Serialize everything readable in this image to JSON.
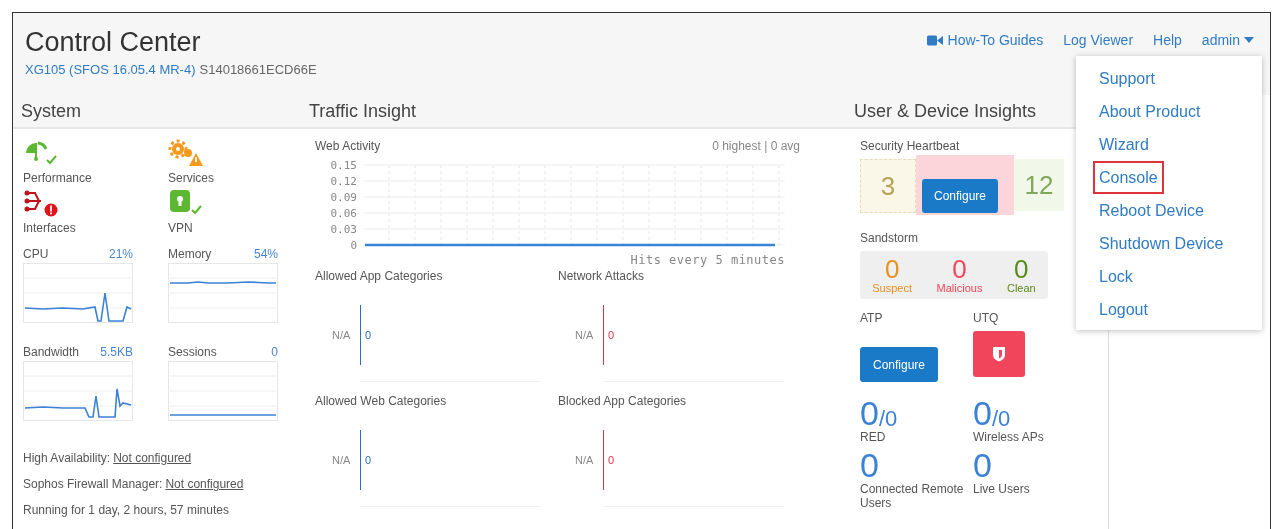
{
  "header": {
    "title": "Control Center",
    "model": "XG105 (SFOS 16.05.4 MR-4)",
    "serial": "S14018661ECD66E"
  },
  "nav": {
    "links": [
      "How-To Guides",
      "Log Viewer",
      "Help"
    ],
    "user": "admin"
  },
  "user_menu": [
    {
      "label": "Support",
      "selected": false
    },
    {
      "label": "About Product",
      "selected": false
    },
    {
      "label": "Wizard",
      "selected": false
    },
    {
      "label": "Console",
      "selected": true
    },
    {
      "label": "Reboot Device",
      "selected": false
    },
    {
      "label": "Shutdown Device",
      "selected": false
    },
    {
      "label": "Lock",
      "selected": false
    },
    {
      "label": "Logout",
      "selected": false
    }
  ],
  "system": {
    "title": "System",
    "statuses": [
      {
        "kind": "performance",
        "label": "Performance",
        "badge": {
          "kind": "check",
          "color": "#5cb82e"
        }
      },
      {
        "kind": "services",
        "label": "Services",
        "badge": {
          "kind": "warning",
          "color": "#f39a1e"
        }
      },
      {
        "kind": "interfaces",
        "label": "Interfaces",
        "badge": {
          "kind": "error",
          "color": "#e0121b"
        }
      },
      {
        "kind": "vpn",
        "label": "VPN",
        "badge": {
          "kind": "check",
          "color": "#5cb82e"
        }
      }
    ],
    "metrics": [
      {
        "label": "CPU",
        "value": "21%"
      },
      {
        "label": "Memory",
        "value": "54%"
      },
      {
        "label": "Bandwidth",
        "value": "5.5KB"
      },
      {
        "label": "Sessions",
        "value": "0"
      }
    ],
    "info": [
      {
        "label": "High Availability:",
        "link": "Not configured"
      },
      {
        "label": "Sophos Firewall Manager:",
        "link": "Not configured"
      },
      {
        "label": "Running for 1 day, 2 hours, 57 minutes"
      }
    ]
  },
  "traffic": {
    "title": "Traffic Insight",
    "web_activity": {
      "title": "Web Activity",
      "summary": "0 highest | 0 avg",
      "chart_data": {
        "type": "line",
        "xlabel": "Hits every 5 minutes",
        "ylim": [
          0,
          0.15
        ],
        "yticks": [
          {
            "value": 0.15,
            "label": "0.15"
          },
          {
            "value": 0.12,
            "label": "0.12"
          },
          {
            "value": 0.09,
            "label": "0.09"
          },
          {
            "value": 0.06,
            "label": "0.06"
          },
          {
            "value": 0.03,
            "label": "0.03"
          },
          {
            "value": 0,
            "label": "0"
          }
        ],
        "grid": true,
        "series": [
          {
            "color": "#3b82d6",
            "values": [
              0,
              0,
              0,
              0,
              0,
              0,
              0,
              0,
              0,
              0,
              0,
              0,
              0,
              0,
              0,
              0,
              0
            ]
          }
        ]
      }
    },
    "widgets": [
      {
        "title": "Allowed App Categories",
        "label": "N/A",
        "value": "0",
        "color": "#2f6fb8"
      },
      {
        "title": "Network Attacks",
        "label": "N/A",
        "value": "0",
        "color": "#e0324b"
      },
      {
        "title": "Allowed Web Categories",
        "label": "N/A",
        "value": "0",
        "color": "#2f6fb8"
      },
      {
        "title": "Blocked App Categories",
        "label": "N/A",
        "value": "0",
        "color": "#e0324b"
      }
    ]
  },
  "insights": {
    "title": "User & Device Insights",
    "heartbeat": {
      "title": "Security Heartbeat",
      "warnings": "3",
      "healthy": "12",
      "button": "Configure"
    },
    "sandstorm": {
      "title": "Sandstorm",
      "counts": [
        {
          "value": "0",
          "label": "Suspect",
          "color": "#e8901c"
        },
        {
          "value": "0",
          "label": "Malicious",
          "color": "#f0455a"
        },
        {
          "value": "0",
          "label": "Clean",
          "color": "#5a8a1a"
        }
      ]
    },
    "atp": {
      "title": "ATP",
      "button": "Configure"
    },
    "utq": {
      "title": "UTQ"
    },
    "counters": [
      {
        "value": "0",
        "total": "/0",
        "label": "RED"
      },
      {
        "value": "0",
        "total": "/0",
        "label": "Wireless APs"
      },
      {
        "value": "0",
        "label": "Connected Remote Users"
      },
      {
        "value": "0",
        "label": "Live Users"
      }
    ]
  }
}
